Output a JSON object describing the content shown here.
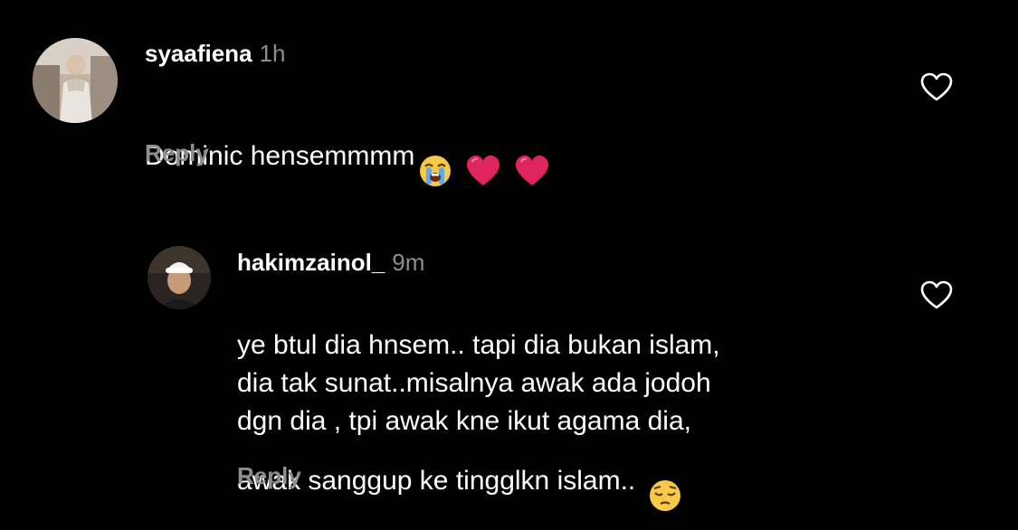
{
  "comments": [
    {
      "username": "syaafiena",
      "time": "1h",
      "text": "Dominic hensemmmm",
      "emojis": [
        "loudly-crying-face",
        "red-heart",
        "red-heart"
      ],
      "reply_label": "Reply"
    },
    {
      "username": "hakimzainol_",
      "time": "9m",
      "text": "ye btul dia hnsem.. tapi dia bukan islam,\ndia tak sunat..misalnya awak ada jodoh\ndgn dia , tpi awak kne ikut agama dia,\nawak sanggup ke tingglkn islam..",
      "emojis": [
        "pensive-face"
      ],
      "reply_label": "Reply"
    }
  ],
  "colors": {
    "background": "#000000",
    "text": "#ffffff",
    "secondary": "#8e8e8e",
    "heart": "#e0245e"
  },
  "icons": {
    "like": "heart-outline-icon"
  }
}
